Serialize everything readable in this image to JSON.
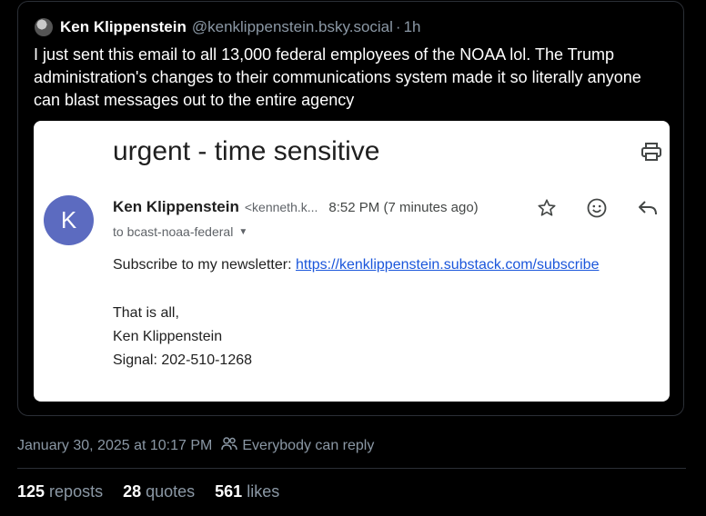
{
  "quoted_post": {
    "author_name": "Ken Klippenstein",
    "author_handle": "@kenklippenstein.bsky.social",
    "separator": "·",
    "time_ago": "1h",
    "text": "I just sent this email to all 13,000 federal employees of the NOAA lol. The Trump administration's changes to their communications system made it so literally anyone can blast messages out to the entire agency"
  },
  "email": {
    "subject": "urgent - time sensitive",
    "avatar_letter": "K",
    "sender_name": "Ken Klippenstein",
    "sender_email_truncated": "<kenneth.k...",
    "sent_time": "8:52 PM (7 minutes ago)",
    "to_line": "to bcast-noaa-federal",
    "body_prefix": "Subscribe to my newsletter: ",
    "body_link": "https://kenklippenstein.substack.com/subscribe",
    "closing": "That is all,",
    "signature_name": "Ken Klippenstein",
    "signature_signal": "Signal: 202-510-1268",
    "icons": [
      "print-icon",
      "star-icon",
      "emoji-icon",
      "reply-icon",
      "chevron-down-icon"
    ]
  },
  "post_meta": {
    "timestamp": "January 30, 2025 at 10:17 PM",
    "reply_setting": "Everybody can reply"
  },
  "stats": {
    "reposts_count": "125",
    "reposts_label": "reposts",
    "quotes_count": "28",
    "quotes_label": "quotes",
    "likes_count": "561",
    "likes_label": "likes"
  },
  "colors": {
    "background": "#000000",
    "muted_text": "#8b98a5",
    "email_avatar": "#5c6bc0",
    "link": "#1a56db"
  }
}
